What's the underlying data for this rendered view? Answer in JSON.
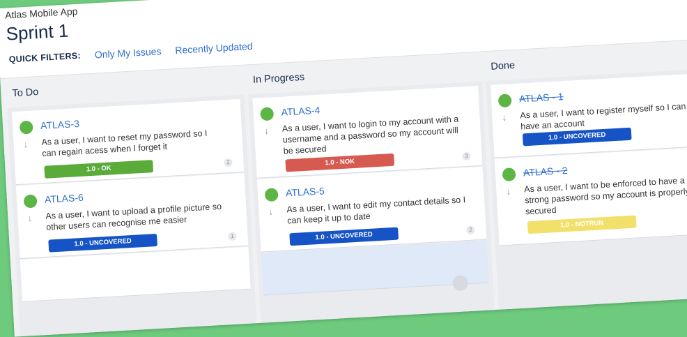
{
  "project": "Atlas Mobile App",
  "sprint": "Sprint 1",
  "quick_filters": {
    "label": "QUICK FILTERS:",
    "items": [
      "Only My Issues",
      "Recently Updated"
    ]
  },
  "columns": [
    {
      "title": "To Do",
      "cards": [
        {
          "key": "ATLAS-3",
          "summary": "As a user, I want to reset my password so I can regain acess when I forget it",
          "badge": "1.0 - OK",
          "badge_color": "#5aab3a",
          "points": "2"
        },
        {
          "key": "ATLAS-6",
          "summary": "As a user, I want to upload a profile picture so other users can recognise me easier",
          "badge": "1.0 - UNCOVERED",
          "badge_color": "#1553c7",
          "points": "1"
        }
      ]
    },
    {
      "title": "In Progress",
      "cards": [
        {
          "key": "ATLAS-4",
          "summary": "As a user, I want to login to my account with a username and a password so my account will be secured",
          "badge": "1.0 - NOK",
          "badge_color": "#d65a50",
          "points": "3"
        },
        {
          "key": "ATLAS-5",
          "summary": "As a user, I want to edit my contact details so I can keep it up to date",
          "badge": "1.0 - UNCOVERED",
          "badge_color": "#1553c7",
          "points": "2"
        }
      ]
    },
    {
      "title": "Done",
      "cards": [
        {
          "key": "ATLAS - 1",
          "summary": "As a user, I want to register myself so I can have an account",
          "badge": "1.0 - UNCOVERED",
          "badge_color": "#1553c7",
          "points": ""
        },
        {
          "key": "ATLAS - 2",
          "summary": "As a user, I want to be enforced to have a strong password so my account is properly secured",
          "badge": "1.0 - NOTRUN",
          "badge_color": "#f2e06b",
          "points": ""
        }
      ]
    }
  ]
}
